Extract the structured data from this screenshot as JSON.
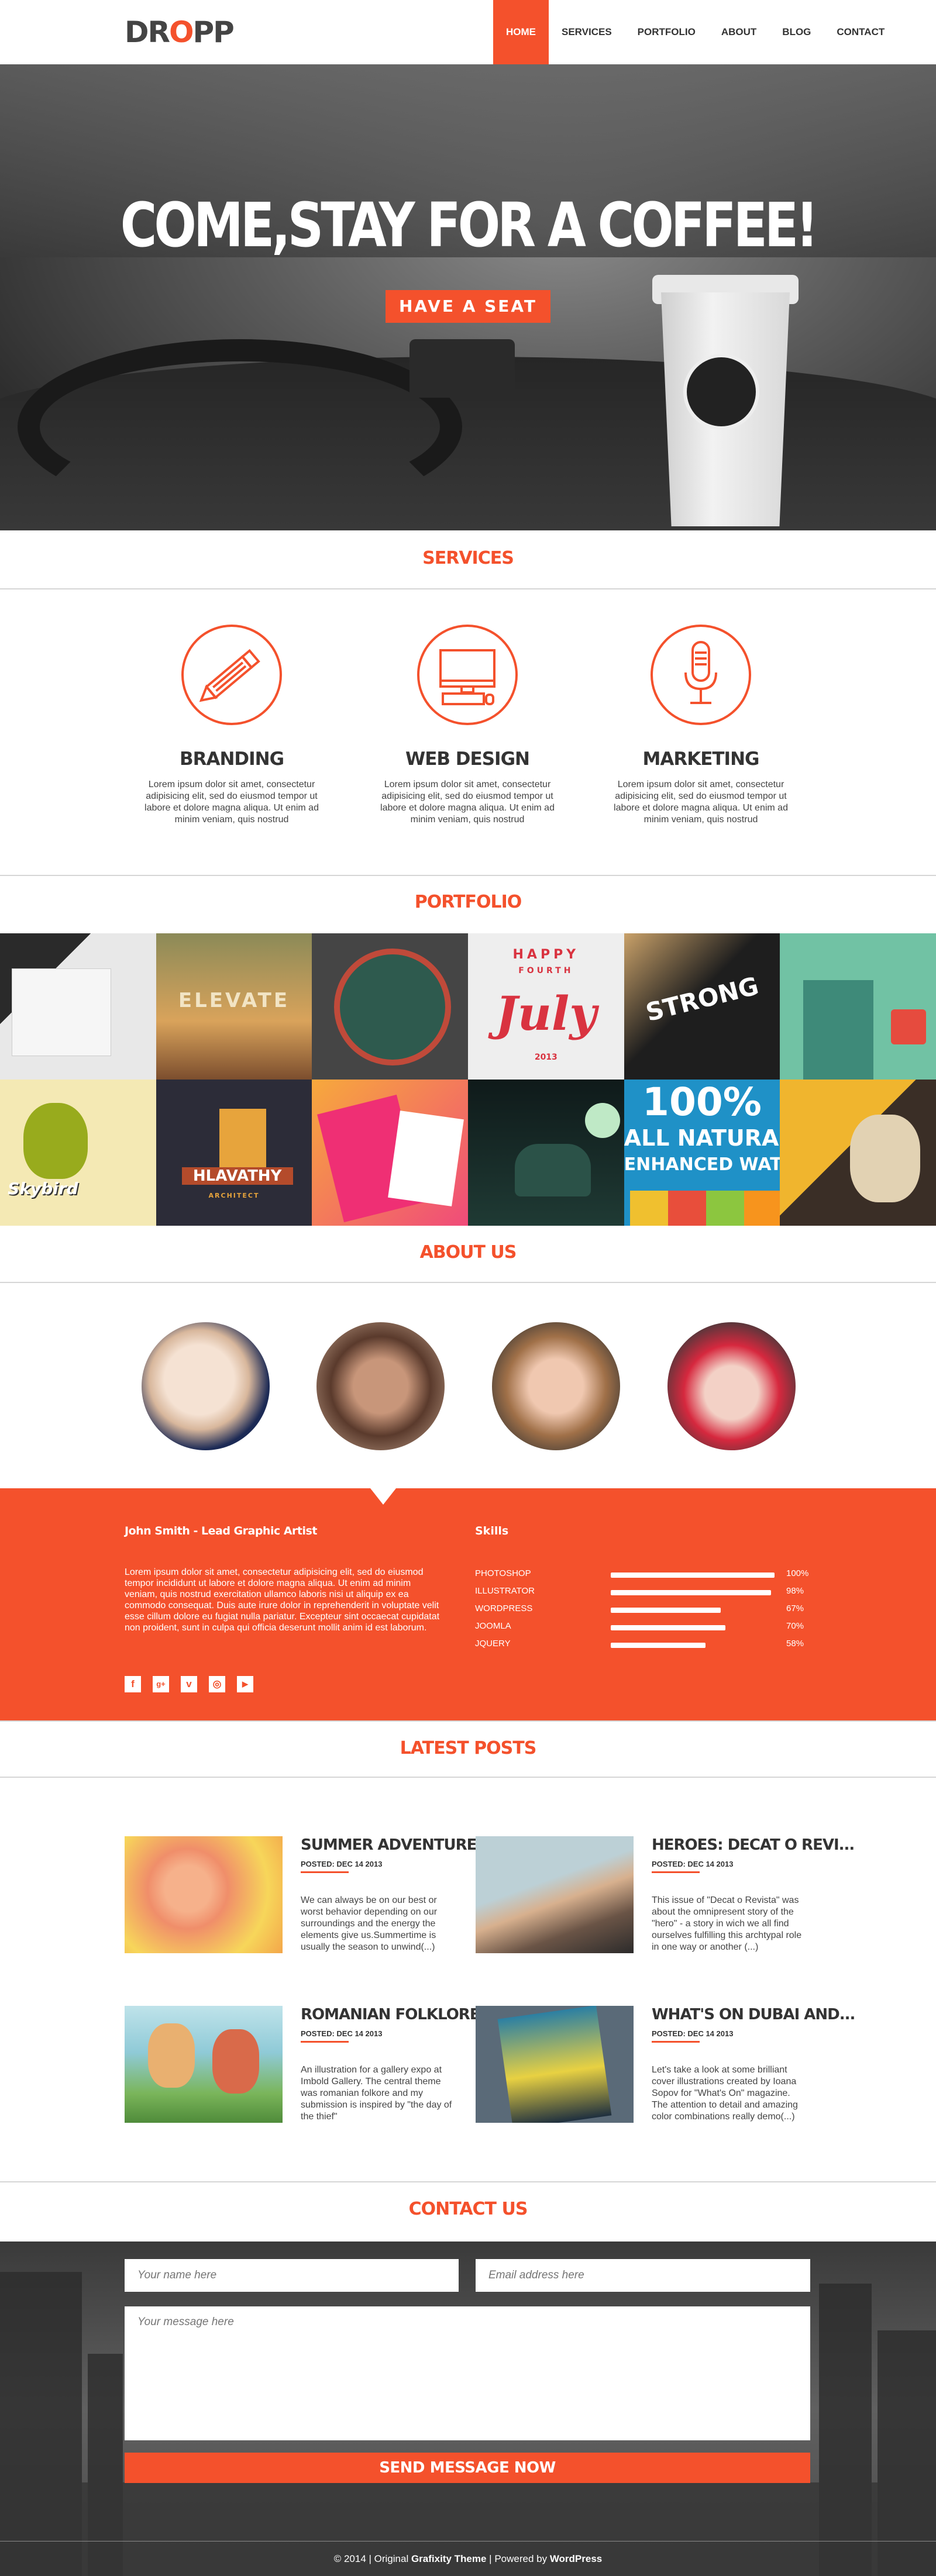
{
  "logo": {
    "pre": "DR",
    "accent": "O",
    "post": "PP"
  },
  "nav": [
    "HOME",
    "SERVICES",
    "PORTFOLIO",
    "ABOUT",
    "BLOG",
    "CONTACT"
  ],
  "hero": {
    "title": "COME,STAY FOR A COFFEE!",
    "cta": "HAVE A SEAT"
  },
  "sections": {
    "services": "SERVICES",
    "portfolio": "PORTFOLIO",
    "about": "ABOUT US",
    "posts": "LATEST POSTS",
    "contact": "CONTACT US"
  },
  "services": [
    {
      "icon": "pencil-icon",
      "title": "BRANDING",
      "text": "Lorem ipsum dolor sit amet, consectetur adipisicing elit, sed do eiusmod tempor ut labore et dolore magna aliqua. Ut enim ad minim veniam, quis nostrud"
    },
    {
      "icon": "monitor-icon",
      "title": "WEB DESIGN",
      "text": "Lorem ipsum dolor sit amet, consectetur adipisicing elit, sed do eiusmod tempor ut labore et dolore magna aliqua. Ut enim ad minim veniam, quis nostrud"
    },
    {
      "icon": "microphone-icon",
      "title": "MARKETING",
      "text": "Lorem ipsum dolor sit amet, consectetur adipisicing elit, sed do eiusmod tempor ut labore et dolore magna aliqua. Ut enim ad minim veniam, quis nostrud"
    }
  ],
  "portfolio": {
    "elevate": "ELEVATE",
    "happy": "HAPPY",
    "fourth": "FOURTH",
    "july": "July",
    "year": "2013",
    "strong": "STRONG",
    "skybird": "Skybird",
    "hlavathy": "HLAVATHY",
    "architect": "ARCHITECT",
    "natural1": "100%",
    "natural2": "ALL NATURAL",
    "natural3": "ENHANCED WATER"
  },
  "about": {
    "bio_title": "John Smith - Lead Graphic Artist",
    "bio_text": "Lorem ipsum dolor sit amet, consectetur adipisicing elit, sed do eiusmod tempor incididunt ut labore et dolore magna aliqua. Ut enim ad minim veniam, quis nostrud exercitation ullamco laboris nisi ut aliquip ex ea commodo consequat. Duis aute irure dolor in reprehenderit in voluptate velit esse cillum dolore eu fugiat nulla pariatur. Excepteur sint occaecat cupidatat non proident, sunt in culpa qui officia deserunt mollit anim id est laborum.",
    "skills_title": "Skills",
    "skills": [
      {
        "name": "PHOTOSHOP",
        "value": "100%",
        "level": 1.0
      },
      {
        "name": "ILLUSTRATOR",
        "value": "98%",
        "level": 0.98
      },
      {
        "name": "WORDPRESS",
        "value": "67%",
        "level": 0.67
      },
      {
        "name": "JOOMLA",
        "value": "70%",
        "level": 0.7
      },
      {
        "name": "JQUERY",
        "value": "58%",
        "level": 0.58
      }
    ],
    "social_icons": [
      "facebook-icon",
      "google-plus-icon",
      "vimeo-icon",
      "instagram-icon",
      "youtube-icon"
    ],
    "social_glyphs": [
      "f",
      "g+",
      "v",
      "◎",
      "▶"
    ]
  },
  "posts": [
    {
      "title": "SUMMER ADVENTURES...",
      "date": "POSTED: DEC 14 2013",
      "text": "We can always be on our best or worst behavior depending on our surroundings and the energy the elements give us.Summertime is usually the season to unwind(...)"
    },
    {
      "title": "HEROES: DECAT O REVI...",
      "date": "POSTED: DEC 14 2013",
      "text": "This issue of \"Decat o Revista\" was about the omnipresent story of the \"hero\" - a story in wich we all find ourselves fulfilling this archtypal role in one way or another (...)"
    },
    {
      "title": "ROMANIAN FOLKLORE",
      "date": "POSTED: DEC 14 2013",
      "text": "An illustration for a gallery expo at Imbold Gallery. The central theme was romanian folkore and my submission is inspired by \"the day of the thief\""
    },
    {
      "title": "WHAT'S ON DUBAI AND...",
      "date": "POSTED: DEC 14 2013",
      "text": "Let's take a look at some brilliant cover illustrations created by Ioana Sopov for \"What's On\" magazine. The attention to detail and amazing color combinations really demo(...)"
    }
  ],
  "contact": {
    "name_ph": "Your name here",
    "email_ph": "Email address here",
    "msg_ph": "Your message here",
    "send": "SEND MESSAGE NOW"
  },
  "footer": {
    "pre": "© 2014 | Original ",
    "theme": "Grafixity Theme",
    "mid": " | Powered by ",
    "wp": "WordPress"
  },
  "colors": {
    "accent": "#f4512c",
    "text": "#333333"
  }
}
